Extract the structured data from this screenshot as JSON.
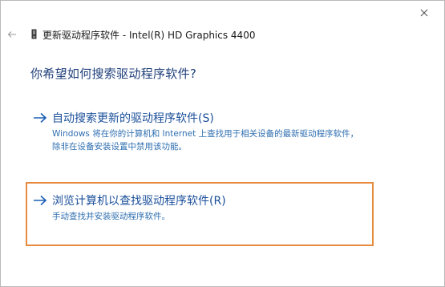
{
  "window": {
    "title": "更新驱动程序软件 - Intel(R) HD Graphics 4400"
  },
  "heading": "你希望如何搜索驱动程序软件?",
  "options": [
    {
      "title": "自动搜索更新的驱动程序软件(S)",
      "description": "Windows 将在你的计算机和 Internet 上查找用于相关设备的最新驱动程序软件，除非在设备安装设置中禁用该功能。"
    },
    {
      "title": "浏览计算机以查找驱动程序软件(R)",
      "description": "手动查找并安装驱动程序软件。"
    }
  ],
  "icons": {
    "back": "back-arrow-icon",
    "close": "close-icon",
    "device": "device-icon",
    "option_arrow": "right-arrow-icon"
  },
  "colors": {
    "accent_link": "#1a4f9a",
    "description": "#2f6fb0",
    "heading": "#1f3f7a",
    "highlight": "#e68a3d"
  }
}
